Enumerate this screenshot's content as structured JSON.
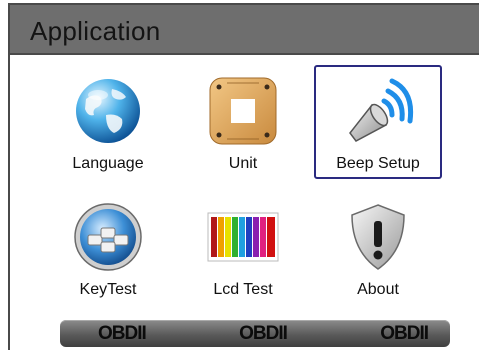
{
  "header": {
    "title": "Application"
  },
  "tiles": [
    {
      "label": "Language",
      "icon": "globe-icon",
      "selected": false
    },
    {
      "label": "Unit",
      "icon": "unit-icon",
      "selected": false
    },
    {
      "label": "Beep Setup",
      "icon": "speaker-icon",
      "selected": true
    },
    {
      "label": "KeyTest",
      "icon": "keyboard-icon",
      "selected": false
    },
    {
      "label": "Lcd Test",
      "icon": "color-bars-icon",
      "selected": false
    },
    {
      "label": "About",
      "icon": "shield-exclamation-icon",
      "selected": false
    }
  ],
  "bottom_bar": {
    "slots": [
      "OBDII",
      "OBDII",
      "OBDII"
    ]
  },
  "colors": {
    "selection_border": "#2a2a80",
    "titlebar": "#6e6e6e"
  }
}
